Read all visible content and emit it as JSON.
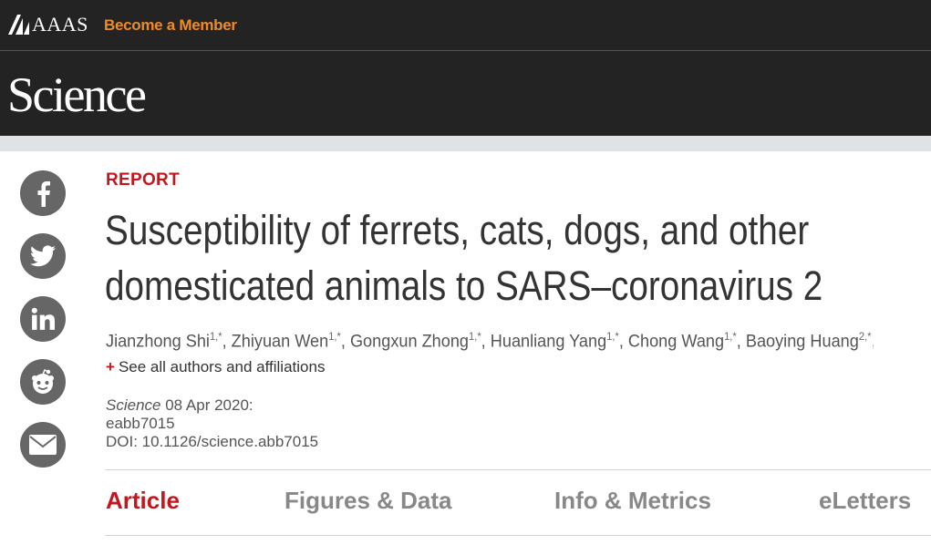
{
  "header": {
    "org_name": "AAAS",
    "member_link": "Become a Member",
    "journal_name": "Science"
  },
  "share": [
    {
      "icon": "facebook-icon"
    },
    {
      "icon": "twitter-icon"
    },
    {
      "icon": "linkedin-icon"
    },
    {
      "icon": "reddit-icon"
    },
    {
      "icon": "email-icon"
    }
  ],
  "article": {
    "kicker": "REPORT",
    "title_lines": [
      "Susceptibility of ferrets, cats, dogs, and other",
      "domesticated animals to SARS–coronavirus 2"
    ],
    "authors": [
      {
        "name": "Jianzhong Shi",
        "sup": "1,*"
      },
      {
        "name": "Zhiyuan Wen",
        "sup": "1,*"
      },
      {
        "name": "Gongxun Zhong",
        "sup": "1,*"
      },
      {
        "name": "Huanliang Yang",
        "sup": "1,*"
      },
      {
        "name": "Chong Wang",
        "sup": "1,*"
      },
      {
        "name": "Baoying Huang",
        "sup": "2,*"
      }
    ],
    "see_all": "See all authors and affiliations",
    "citation": {
      "journal": "Science",
      "date": "08 Apr 2020:",
      "article_id": "eabb7015",
      "doi": "DOI: 10.1126/science.abb7015"
    }
  },
  "tabs": [
    {
      "label": "Article",
      "active": true
    },
    {
      "label": "Figures & Data",
      "active": false
    },
    {
      "label": "Info & Metrics",
      "active": false
    },
    {
      "label": "eLetters",
      "active": false
    }
  ],
  "colors": {
    "header_bg": "#232323",
    "accent_red": "#c4161c",
    "member_orange": "#f08a24",
    "icon_gray": "#666666"
  }
}
